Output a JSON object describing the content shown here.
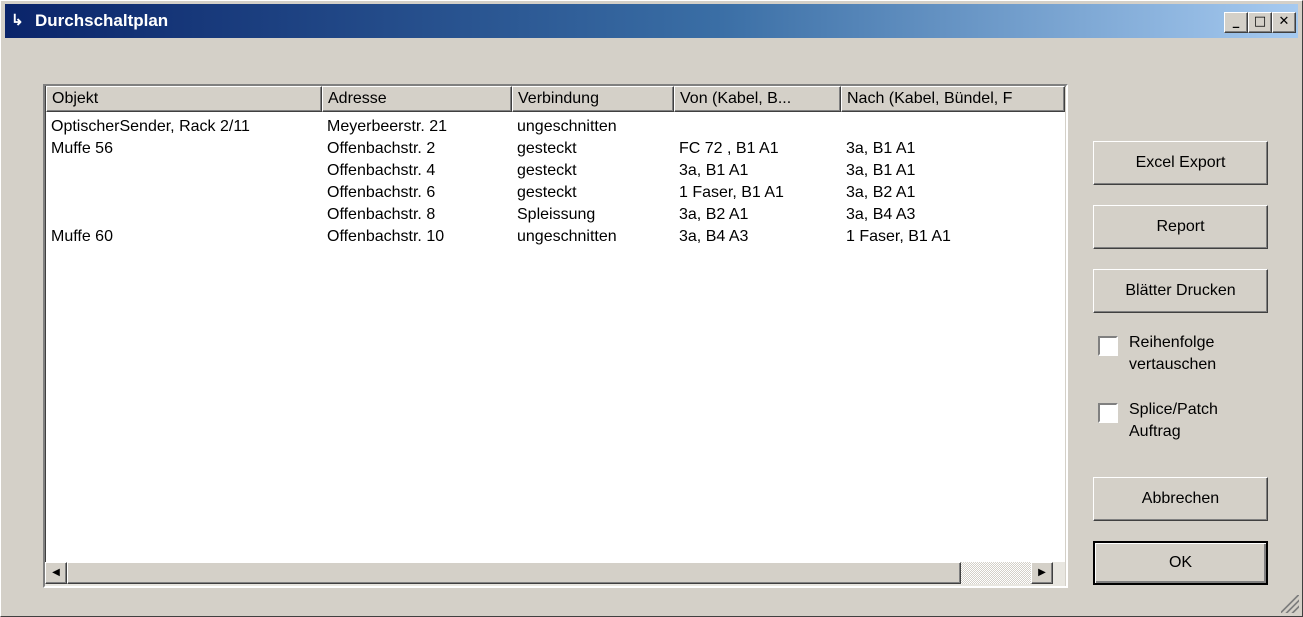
{
  "window": {
    "title": "Durchschaltplan"
  },
  "titlebar_buttons": {
    "minimize": "_",
    "maximize": "□",
    "close": "✕"
  },
  "table": {
    "columns": [
      "Objekt",
      "Adresse",
      "Verbindung",
      "Von (Kabel, B...",
      "Nach (Kabel, Bündel, F"
    ],
    "rows": [
      [
        "OptischerSender, Rack 2/11",
        "Meyerbeerstr. 21",
        "ungeschnitten",
        "",
        ""
      ],
      [
        "Muffe 56",
        "Offenbachstr. 2",
        "gesteckt",
        "FC 72 , B1 A1",
        "3a, B1 A1"
      ],
      [
        "",
        "Offenbachstr. 4",
        "gesteckt",
        "3a, B1 A1",
        "3a, B1 A1"
      ],
      [
        "",
        "Offenbachstr. 6",
        "gesteckt",
        "1 Faser, B1 A1",
        "3a, B2 A1"
      ],
      [
        "",
        "Offenbachstr. 8",
        "Spleissung",
        "3a, B2 A1",
        "3a, B4 A3"
      ],
      [
        "Muffe 60",
        "Offenbachstr. 10",
        "ungeschnitten",
        "3a, B4 A3",
        "1 Faser, B1 A1"
      ]
    ]
  },
  "scrollbar": {
    "left_arrow": "◀",
    "right_arrow": "▶"
  },
  "buttons": {
    "excel_export": "Excel Export",
    "report": "Report",
    "print_sheets": "Blätter Drucken",
    "cancel": "Abbrechen",
    "ok": "OK"
  },
  "checkboxes": {
    "swap_order": {
      "label": "Reihenfolge vertauschen",
      "checked": false
    },
    "splice_patch": {
      "label": "Splice/Patch Auftrag",
      "checked": false
    }
  }
}
